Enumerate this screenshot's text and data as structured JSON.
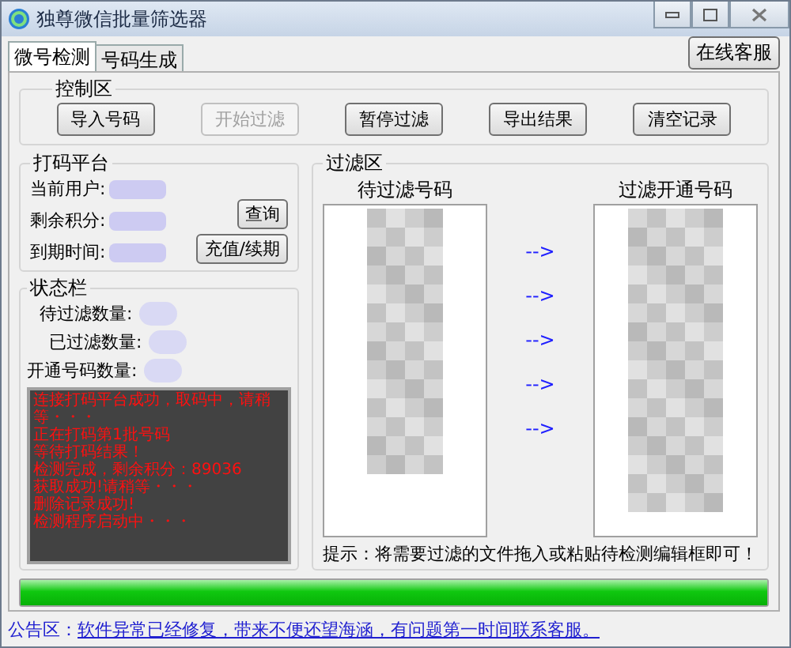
{
  "window": {
    "title": "独尊微信批量筛选器"
  },
  "tabs": [
    {
      "label": "微号检测",
      "selected": true
    },
    {
      "label": "号码生成",
      "selected": false
    }
  ],
  "support_button": "在线客服",
  "control": {
    "title": "控制区",
    "buttons": [
      {
        "label": "导入号码",
        "disabled": false
      },
      {
        "label": "开始过滤",
        "disabled": true
      },
      {
        "label": "暂停过滤",
        "disabled": false
      },
      {
        "label": "导出结果",
        "disabled": false
      },
      {
        "label": "清空记录",
        "disabled": false
      }
    ]
  },
  "platform": {
    "title": "打码平台",
    "fields": [
      {
        "label": "当前用户:"
      },
      {
        "label": "剩余积分:"
      },
      {
        "label": "到期时间:"
      }
    ],
    "buttons": [
      "查询",
      "充值/续期"
    ]
  },
  "status": {
    "title": "状态栏",
    "fields": [
      {
        "label": "待过滤数量:"
      },
      {
        "label": "已过滤数量:"
      },
      {
        "label": "开通号码数量:"
      }
    ],
    "log": [
      "连接打码平台成功，取码中，请稍等・・・",
      "正在打码第1批号码",
      "等待打码结果！",
      "检测完成，剩余积分：89036",
      "获取成功!请稍等・・・",
      "删除记录成功!",
      "检测程序启动中・・・"
    ]
  },
  "filter": {
    "title": "过滤区",
    "left_heading": "待过滤号码",
    "right_heading": "过滤开通号码",
    "arrows": [
      "-->",
      "-->",
      "-->",
      "-->",
      "-->"
    ],
    "tip": "提示：将需要过滤的文件拖入或粘贴待检测编辑框即可！"
  },
  "progress": {
    "level": 1
  },
  "notice": {
    "label": "公告区：",
    "link": "软件异常已经修复，带来不便还望海涵，有问题第一时间联系客服。"
  }
}
